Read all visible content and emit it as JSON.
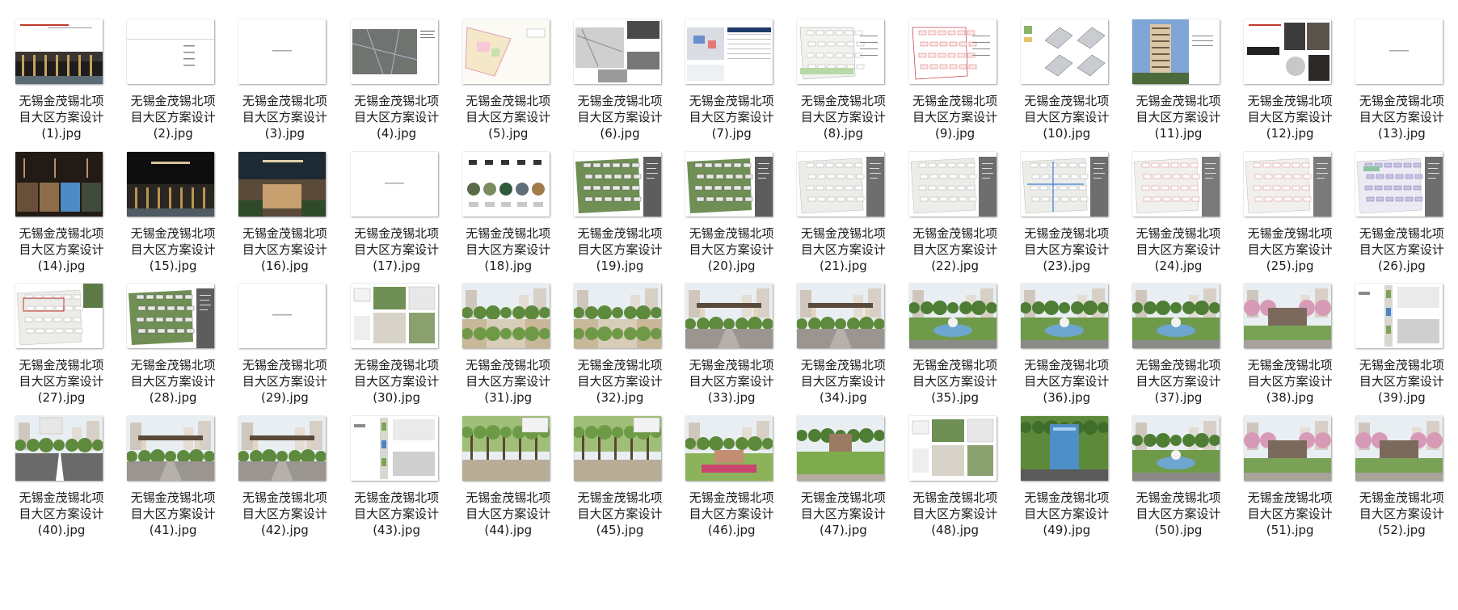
{
  "window": {
    "title": "无锡金茂锡北项目大区方案设计"
  },
  "files": [
    {
      "line1": "无锡金茂锡北项",
      "line2": "目大区方案设计",
      "line3": "(1).jpg",
      "kind": "cover-photo",
      "alt": "top-note"
    },
    {
      "line1": "无锡金茂锡北项",
      "line2": "目大区方案设计",
      "line3": "(2).jpg",
      "kind": "text-index",
      "alt": ""
    },
    {
      "line1": "无锡金茂锡北项",
      "line2": "目大区方案设计",
      "line3": "(3).jpg",
      "kind": "blank-title",
      "alt": ""
    },
    {
      "line1": "无锡金茂锡北项",
      "line2": "目大区方案设计",
      "line3": "(4).jpg",
      "kind": "aerial-map",
      "alt": ""
    },
    {
      "line1": "无锡金茂锡北项",
      "line2": "目大区方案设计",
      "line3": "(5).jpg",
      "kind": "color-site-plan",
      "alt": ""
    },
    {
      "line1": "无锡金茂锡北项",
      "line2": "目大区方案设计",
      "line3": "(6).jpg",
      "kind": "bw-collage",
      "alt": ""
    },
    {
      "line1": "无锡金茂锡北项",
      "line2": "目大区方案设计",
      "line3": "(7).jpg",
      "kind": "map-table",
      "alt": ""
    },
    {
      "line1": "无锡金茂锡北项",
      "line2": "目大区方案设计",
      "line3": "(8).jpg",
      "kind": "site-plan",
      "alt": ""
    },
    {
      "line1": "无锡金茂锡北项",
      "line2": "目大区方案设计",
      "line3": "(9).jpg",
      "kind": "red-plan",
      "alt": ""
    },
    {
      "line1": "无锡金茂锡北项",
      "line2": "目大区方案设计",
      "line3": "(10).jpg",
      "kind": "axon",
      "alt": ""
    },
    {
      "line1": "无锡金茂锡北项",
      "line2": "目大区方案设计",
      "line3": "(11).jpg",
      "kind": "tower",
      "alt": ""
    },
    {
      "line1": "无锡金茂锡北项",
      "line2": "目大区方案设计",
      "line3": "(12).jpg",
      "kind": "mood",
      "alt": ""
    },
    {
      "line1": "无锡金茂锡北项",
      "line2": "目大区方案设计",
      "line3": "(13).jpg",
      "kind": "blank-title",
      "alt": ""
    },
    {
      "line1": "无锡金茂锡北项",
      "line2": "目大区方案设计",
      "line3": "(14).jpg",
      "kind": "dark-panels",
      "alt": ""
    },
    {
      "line1": "无锡金茂锡北项",
      "line2": "目大区方案设计",
      "line3": "(15).jpg",
      "kind": "dark-title",
      "alt": "“自然禾境，洵美逸乡”"
    },
    {
      "line1": "无锡金茂锡北项",
      "line2": "目大区方案设计",
      "line3": "(16).jpg",
      "kind": "dark-title2",
      "alt": "“印院匠心”"
    },
    {
      "line1": "无锡金茂锡北项",
      "line2": "目大区方案设计",
      "line3": "(17).jpg",
      "kind": "blank-title",
      "alt": ""
    },
    {
      "line1": "无锡金茂锡北项",
      "line2": "目大区方案设计",
      "line3": "(18).jpg",
      "kind": "circles",
      "alt": "礼 悦 境 趣 享"
    },
    {
      "line1": "无锡金茂锡北项",
      "line2": "目大区方案设计",
      "line3": "(19).jpg",
      "kind": "green-plan",
      "alt": ""
    },
    {
      "line1": "无锡金茂锡北项",
      "line2": "目大区方案设计",
      "line3": "(20).jpg",
      "kind": "green-plan",
      "alt": ""
    },
    {
      "line1": "无锡金茂锡北项",
      "line2": "目大区方案设计",
      "line3": "(21).jpg",
      "kind": "gray-plan",
      "alt": ""
    },
    {
      "line1": "无锡金茂锡北项",
      "line2": "目大区方案设计",
      "line3": "(22).jpg",
      "kind": "gray-plan",
      "alt": ""
    },
    {
      "line1": "无锡金茂锡北项",
      "line2": "目大区方案设计",
      "line3": "(23).jpg",
      "kind": "gray-plan-blue",
      "alt": ""
    },
    {
      "line1": "无锡金茂锡北项",
      "line2": "目大区方案设计",
      "line3": "(24).jpg",
      "kind": "gray-plan-red",
      "alt": ""
    },
    {
      "line1": "无锡金茂锡北项",
      "line2": "目大区方案设计",
      "line3": "(25).jpg",
      "kind": "gray-plan-red",
      "alt": ""
    },
    {
      "line1": "无锡金茂锡北项",
      "line2": "目大区方案设计",
      "line3": "(26).jpg",
      "kind": "purple-plan",
      "alt": ""
    },
    {
      "line1": "无锡金茂锡北项",
      "line2": "目大区方案设计",
      "line3": "(27).jpg",
      "kind": "gray-plan-redline",
      "alt": ""
    },
    {
      "line1": "无锡金茂锡北项",
      "line2": "目大区方案设计",
      "line3": "(28).jpg",
      "kind": "green-plan",
      "alt": ""
    },
    {
      "line1": "无锡金茂锡北项",
      "line2": "目大区方案设计",
      "line3": "(29).jpg",
      "kind": "blank-title",
      "alt": ""
    },
    {
      "line1": "无锡金茂锡北项",
      "line2": "目大区方案设计",
      "line3": "(30).jpg",
      "kind": "photo-board",
      "alt": ""
    },
    {
      "line1": "无锡金茂锡北项",
      "line2": "目大区方案设计",
      "line3": "(31).jpg",
      "kind": "render",
      "alt": ""
    },
    {
      "line1": "无锡金茂锡北项",
      "line2": "目大区方案设计",
      "line3": "(32).jpg",
      "kind": "render",
      "alt": ""
    },
    {
      "line1": "无锡金茂锡北项",
      "line2": "目大区方案设计",
      "line3": "(33).jpg",
      "kind": "render-gate",
      "alt": ""
    },
    {
      "line1": "无锡金茂锡北项",
      "line2": "目大区方案设计",
      "line3": "(34).jpg",
      "kind": "render-gate",
      "alt": ""
    },
    {
      "line1": "无锡金茂锡北项",
      "line2": "目大区方案设计",
      "line3": "(35).jpg",
      "kind": "render-fountain",
      "alt": ""
    },
    {
      "line1": "无锡金茂锡北项",
      "line2": "目大区方案设计",
      "line3": "(36).jpg",
      "kind": "render-fountain",
      "alt": ""
    },
    {
      "line1": "无锡金茂锡北项",
      "line2": "目大区方案设计",
      "line3": "(37).jpg",
      "kind": "render-fountain",
      "alt": ""
    },
    {
      "line1": "无锡金茂锡北项",
      "line2": "目大区方案设计",
      "line3": "(38).jpg",
      "kind": "render-pink",
      "alt": ""
    },
    {
      "line1": "无锡金茂锡北项",
      "line2": "目大区方案设计",
      "line3": "(39).jpg",
      "kind": "plan-strip",
      "alt": ""
    },
    {
      "line1": "无锡金茂锡北项",
      "line2": "目大区方案设计",
      "line3": "(40).jpg",
      "kind": "render-road",
      "alt": ""
    },
    {
      "line1": "无锡金茂锡北项",
      "line2": "目大区方案设计",
      "line3": "(41).jpg",
      "kind": "render-gate",
      "alt": ""
    },
    {
      "line1": "无锡金茂锡北项",
      "line2": "目大区方案设计",
      "line3": "(42).jpg",
      "kind": "render-gate",
      "alt": ""
    },
    {
      "line1": "无锡金茂锡北项",
      "line2": "目大区方案设计",
      "line3": "(43).jpg",
      "kind": "plan-strip",
      "alt": ""
    },
    {
      "line1": "无锡金茂锡北项",
      "line2": "目大区方案设计",
      "line3": "(44).jpg",
      "kind": "render-trees",
      "alt": ""
    },
    {
      "line1": "无锡金茂锡北项",
      "line2": "目大区方案设计",
      "line3": "(45).jpg",
      "kind": "render-trees",
      "alt": ""
    },
    {
      "line1": "无锡金茂锡北项",
      "line2": "目大区方案设计",
      "line3": "(46).jpg",
      "kind": "render-flowers",
      "alt": ""
    },
    {
      "line1": "无锡金茂锡北项",
      "line2": "目大区方案设计",
      "line3": "(47).jpg",
      "kind": "render-lawn",
      "alt": ""
    },
    {
      "line1": "无锡金茂锡北项",
      "line2": "目大区方案设计",
      "line3": "(48).jpg",
      "kind": "photo-board",
      "alt": ""
    },
    {
      "line1": "无锡金茂锡北项",
      "line2": "目大区方案设计",
      "line3": "(49).jpg",
      "kind": "render-pool",
      "alt": ""
    },
    {
      "line1": "无锡金茂锡北项",
      "line2": "目大区方案设计",
      "line3": "(50).jpg",
      "kind": "render-fountain",
      "alt": ""
    },
    {
      "line1": "无锡金茂锡北项",
      "line2": "目大区方案设计",
      "line3": "(51).jpg",
      "kind": "render-pink",
      "alt": ""
    },
    {
      "line1": "无锡金茂锡北项",
      "line2": "目大区方案设计",
      "line3": "(52).jpg",
      "kind": "render-pink",
      "alt": ""
    }
  ]
}
